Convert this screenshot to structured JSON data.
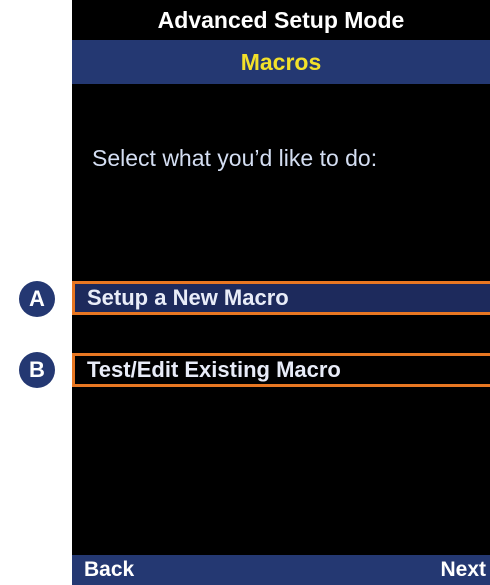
{
  "screen": {
    "title": "Advanced Setup Mode",
    "header": "Macros",
    "prompt": "Select what you’d like to do:"
  },
  "menu": {
    "items": [
      {
        "label": "Setup a New Macro",
        "badge": "A",
        "selected": true
      },
      {
        "label": "Test/Edit Existing Macro",
        "badge": "B",
        "selected": false
      }
    ]
  },
  "softkeys": {
    "left": "Back",
    "right": "Next"
  },
  "colors": {
    "header_bg": "#243872",
    "header_text": "#f2e02a",
    "highlight_border": "#e87722",
    "screen_bg": "#000000"
  }
}
